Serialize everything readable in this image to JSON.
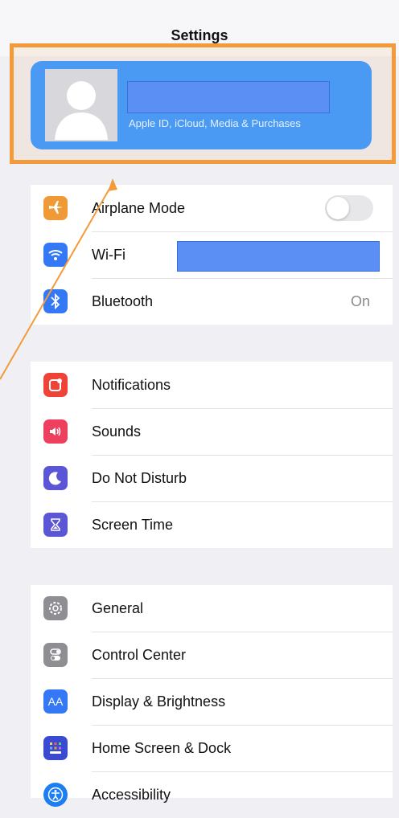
{
  "header": {
    "title": "Settings"
  },
  "profile": {
    "subtitle": "Apple ID, iCloud, Media & Purchases"
  },
  "group1": [
    {
      "label": "Airplane Mode",
      "icon": "airplane-icon",
      "color": "#f09a37"
    },
    {
      "label": "Wi-Fi",
      "icon": "wifi-icon",
      "color": "#3478f6"
    },
    {
      "label": "Bluetooth",
      "icon": "bluetooth-icon",
      "color": "#3478f6",
      "value": "On"
    }
  ],
  "group2": [
    {
      "label": "Notifications",
      "icon": "notifications-icon",
      "color": "#f04337"
    },
    {
      "label": "Sounds",
      "icon": "speaker-icon",
      "color": "#ef3f5f"
    },
    {
      "label": "Do Not Disturb",
      "icon": "moon-icon",
      "color": "#5b56d6"
    },
    {
      "label": "Screen Time",
      "icon": "hourglass-icon",
      "color": "#5b56d6"
    }
  ],
  "group3": [
    {
      "label": "General",
      "icon": "gear-icon",
      "color": "#8e8e93"
    },
    {
      "label": "Control Center",
      "icon": "toggles-icon",
      "color": "#8e8e93"
    },
    {
      "label": "Display & Brightness",
      "icon": "text-size-icon",
      "color": "#3478f6",
      "glyph": "AA"
    },
    {
      "label": "Home Screen & Dock",
      "icon": "grid-icon",
      "color": "#3a4bd1"
    },
    {
      "label": "Accessibility",
      "icon": "accessibility-icon",
      "color": "#1d7ef2"
    }
  ],
  "colors": {
    "highlight": "#f39a3b",
    "profile_bg": "#4a9af4",
    "redaction": "#5b8ff3"
  }
}
